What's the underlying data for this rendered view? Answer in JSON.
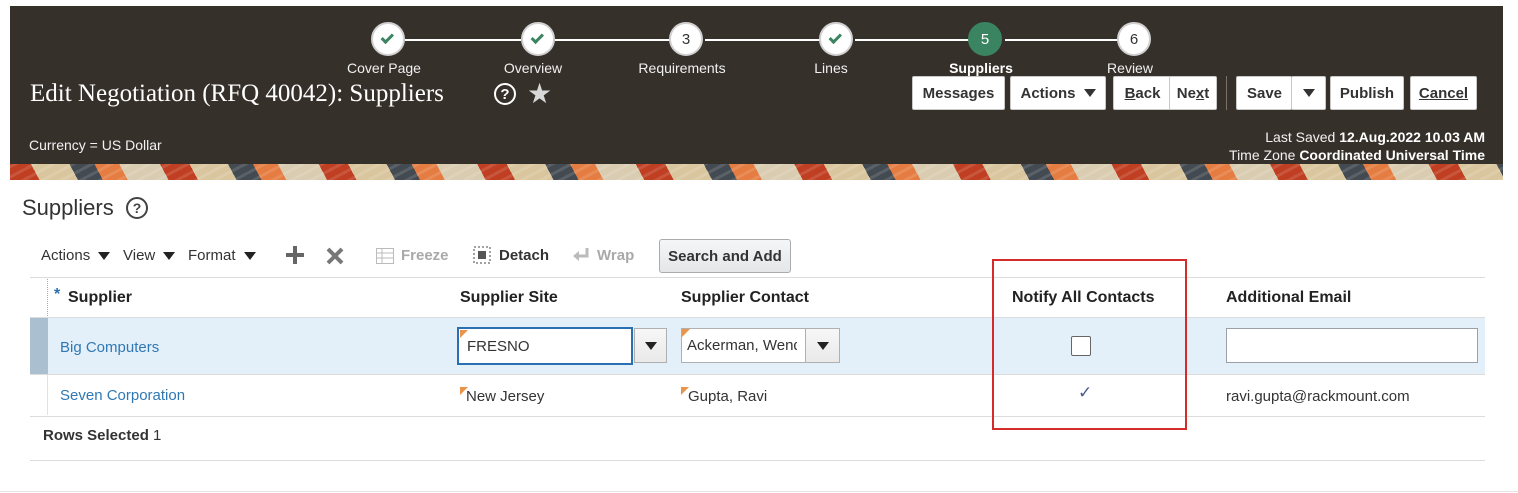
{
  "train": {
    "steps": [
      {
        "label": "Cover Page",
        "num": "",
        "state": "done"
      },
      {
        "label": "Overview",
        "num": "",
        "state": "done"
      },
      {
        "label": "Requirements",
        "num": "3",
        "state": "pending"
      },
      {
        "label": "Lines",
        "num": "",
        "state": "done"
      },
      {
        "label": "Suppliers",
        "num": "5",
        "state": "current"
      },
      {
        "label": "Review",
        "num": "6",
        "state": "pending"
      }
    ]
  },
  "header": {
    "title": "Edit Negotiation (RFQ 40042): Suppliers",
    "help": "?",
    "currency": "Currency = US Dollar",
    "last_saved_label": "Last Saved",
    "last_saved_value": "12.Aug.2022 10.03 AM",
    "timezone_label": "Time Zone",
    "timezone_value": "Coordinated Universal Time"
  },
  "buttons": {
    "messages": "Messages",
    "actions": "Actions",
    "back_first": "B",
    "back_rest": "ack",
    "next_first": "Ne",
    "next_u": "x",
    "next_rest": "t",
    "save": "Save",
    "publish": "Publish",
    "cancel_first": "C",
    "cancel_rest": "ancel"
  },
  "section": {
    "title": "Suppliers",
    "help": "?"
  },
  "toolbar": {
    "actions": "Actions",
    "view": "View",
    "format": "Format",
    "freeze": "Freeze",
    "detach": "Detach",
    "wrap": "Wrap",
    "search_and_add": "Search and Add"
  },
  "table": {
    "required_mark": "*",
    "columns": {
      "supplier": "Supplier",
      "site": "Supplier Site",
      "contact": "Supplier Contact",
      "notify": "Notify All Contacts",
      "email": "Additional Email"
    },
    "rows": [
      {
        "supplier": "Big Computers",
        "site": "FRESNO",
        "contact": "Ackerman, Wendy",
        "notify": false,
        "email": ""
      },
      {
        "supplier": "Seven Corporation",
        "site": "New Jersey",
        "contact": "Gupta, Ravi",
        "notify": true,
        "email": "ravi.gupta@rackmount.com"
      }
    ]
  },
  "footer": {
    "rows_selected_label": "Rows Selected",
    "rows_selected_value": "1"
  },
  "colors": {
    "header_bg": "#36302b",
    "current_step": "#3b8462",
    "link": "#2f78b4",
    "selected_row": "#e4f0f9",
    "highlight_box": "#d42b2b"
  }
}
